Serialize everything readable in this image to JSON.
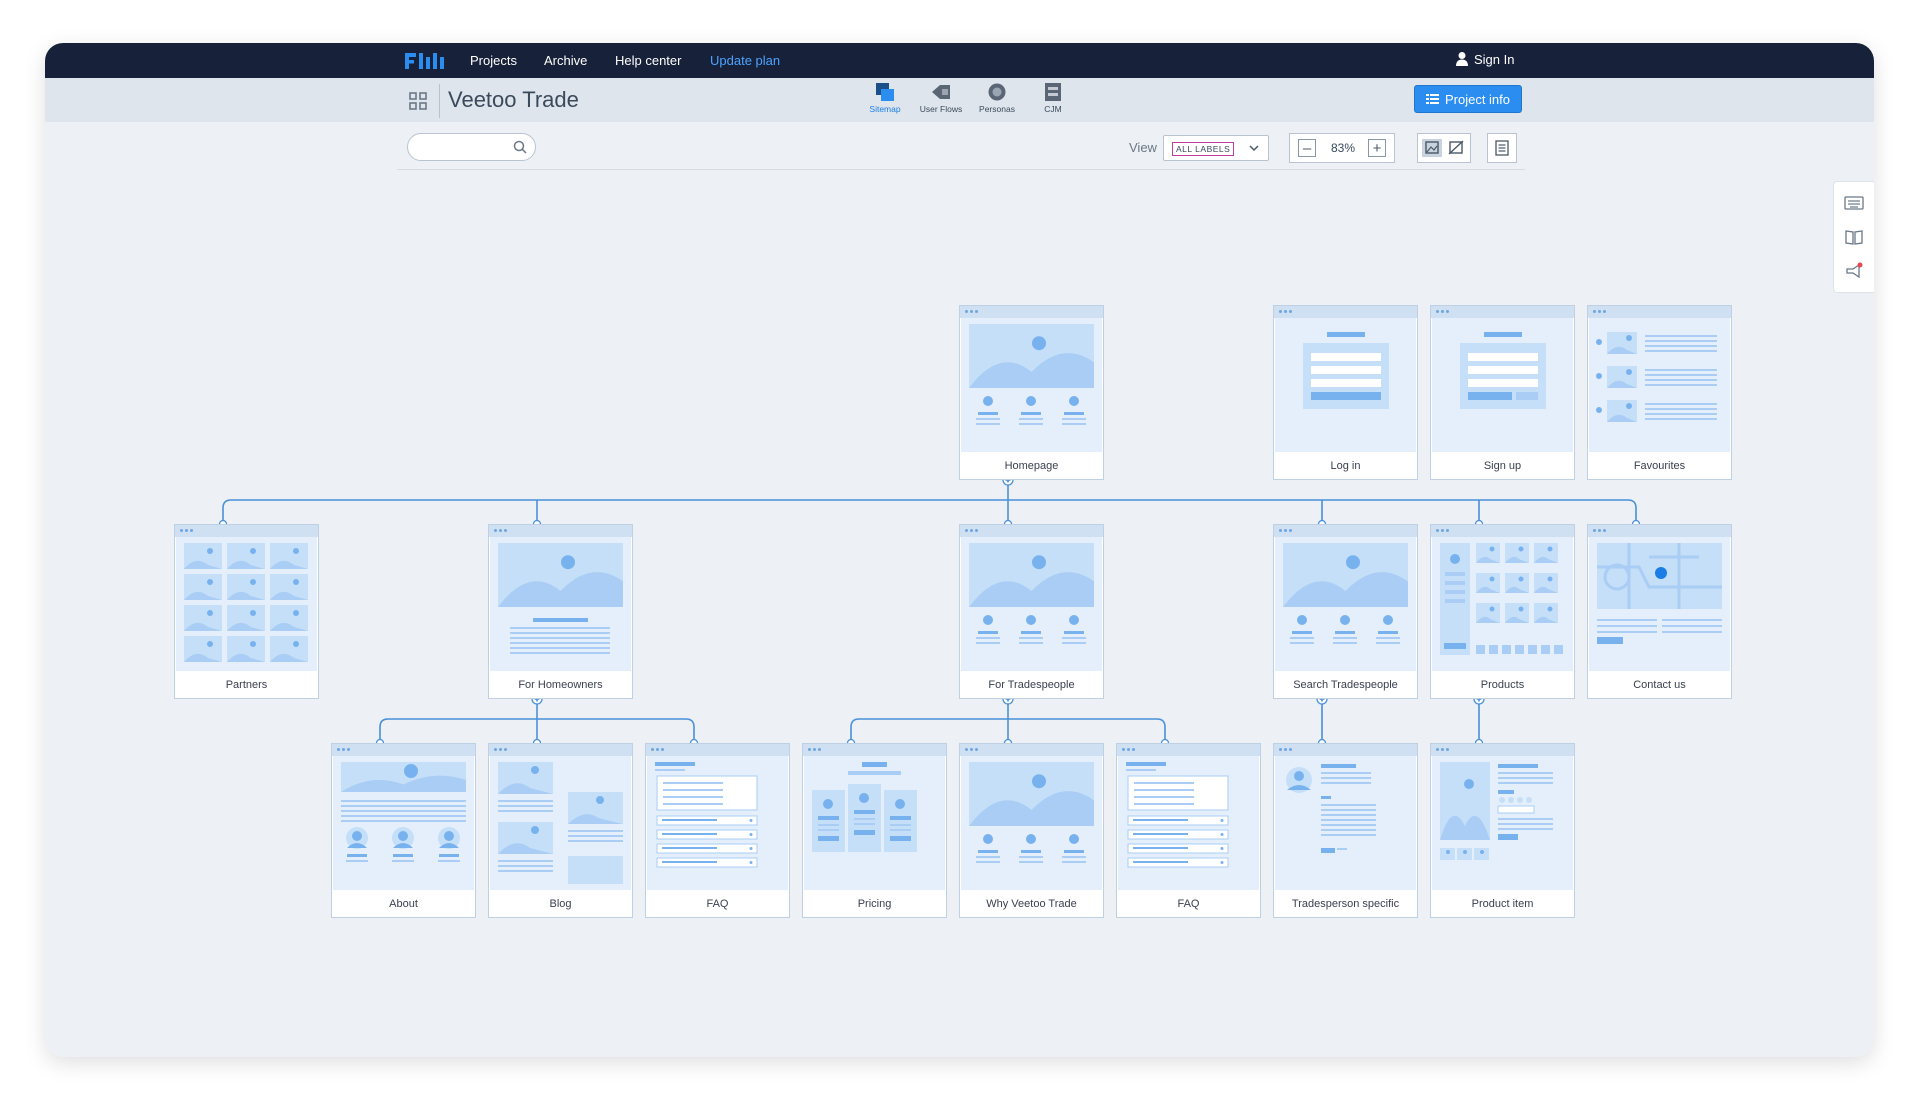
{
  "app": {
    "nav": [
      {
        "label": "Projects",
        "accent": false
      },
      {
        "label": "Archive",
        "accent": false
      },
      {
        "label": "Help center",
        "accent": false
      },
      {
        "label": "Update plan",
        "accent": true
      }
    ],
    "sign_in": "Sign In"
  },
  "project": {
    "title": "Veetoo Trade",
    "info_button": "Project info"
  },
  "modes": [
    {
      "label": "Sitemap",
      "icon": "sitemap-icon",
      "active": true
    },
    {
      "label": "User Flows",
      "icon": "user-flows-icon",
      "active": false
    },
    {
      "label": "Personas",
      "icon": "personas-icon",
      "active": false
    },
    {
      "label": "CJM",
      "icon": "cjm-icon",
      "active": false
    }
  ],
  "toolbar": {
    "search_placeholder": "",
    "view_label": "View",
    "labels_chip": "ALL LABELS",
    "zoom_value": "83%"
  },
  "colors": {
    "nav_bg": "#18213a",
    "accent": "#2b8def",
    "connector": "#4a90d9",
    "wire": "#a9cdf4",
    "wire_dark": "#78b2ee"
  },
  "sitemap": {
    "pages": [
      {
        "label": "Homepage",
        "thumb": "hero"
      },
      {
        "label": "Log in",
        "thumb": "login"
      },
      {
        "label": "Sign up",
        "thumb": "signup"
      },
      {
        "label": "Favourites",
        "thumb": "favourites"
      },
      {
        "label": "Partners",
        "thumb": "gallery"
      },
      {
        "label": "For Homeowners",
        "thumb": "article"
      },
      {
        "label": "For Tradespeople",
        "thumb": "hero"
      },
      {
        "label": "Search Tradespeople",
        "thumb": "hero"
      },
      {
        "label": "Products",
        "thumb": "products"
      },
      {
        "label": "Contact us",
        "thumb": "map"
      },
      {
        "label": "About",
        "thumb": "about"
      },
      {
        "label": "Blog",
        "thumb": "blog"
      },
      {
        "label": "FAQ",
        "thumb": "faq"
      },
      {
        "label": "Pricing",
        "thumb": "pricing"
      },
      {
        "label": "Why Veetoo Trade",
        "thumb": "hero"
      },
      {
        "label": "FAQ",
        "thumb": "faq"
      },
      {
        "label": "Tradesperson specific",
        "thumb": "profile"
      },
      {
        "label": "Product item",
        "thumb": "productitem"
      }
    ]
  }
}
